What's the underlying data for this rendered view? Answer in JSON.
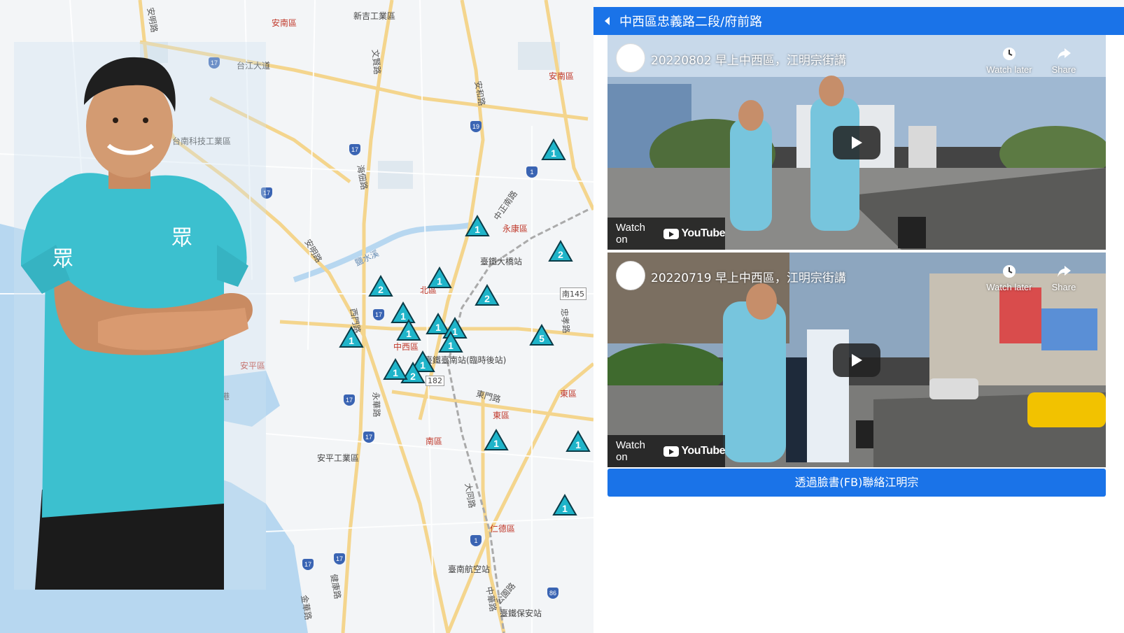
{
  "panel": {
    "title": "中西區忠義路二段/府前路",
    "fb_button": "透過臉書(FB)聯絡江明宗"
  },
  "videos": [
    {
      "title": "20220802 早上中西區，江明宗街講",
      "watch_later": "Watch later",
      "share": "Share",
      "watch_on": "Watch on",
      "youtube": "YouTube"
    },
    {
      "title": "20220719 早上中西區，江明宗街講",
      "watch_later": "Watch later",
      "share": "Share",
      "watch_on": "Watch on",
      "youtube": "YouTube"
    }
  ],
  "map": {
    "places": [
      "新吉工業區",
      "安南區",
      "台江大道",
      "台南科技工業區",
      "安南區",
      "永康區",
      "臺鐵大橋站",
      "北區",
      "中西區",
      "安平區",
      "安平漁港",
      "安平工業區",
      "南區",
      "東區",
      "東區",
      "仁德區",
      "臺南航空站",
      "臺鐵保安站",
      "臺鐵臺南站(臨時後站)",
      "南145",
      "182"
    ],
    "roads": [
      "安明路",
      "安和路",
      "海佃路",
      "中正南路",
      "安明路",
      "鹽水溪",
      "西門路",
      "東門路",
      "大同路",
      "文賢路",
      "忠孝路",
      "永華路",
      "健康路",
      "中華路",
      "公園路",
      "金華路"
    ],
    "markers": [
      "1",
      "1",
      "2",
      "2",
      "1",
      "2",
      "1",
      "1",
      "1",
      "1",
      "1",
      "1",
      "5",
      "1",
      "2",
      "1",
      "1",
      "1",
      "1"
    ],
    "marker_color": "#1fb4c9"
  },
  "colors": {
    "header": "#1a73e8",
    "shirt": "#3cc0cf"
  }
}
